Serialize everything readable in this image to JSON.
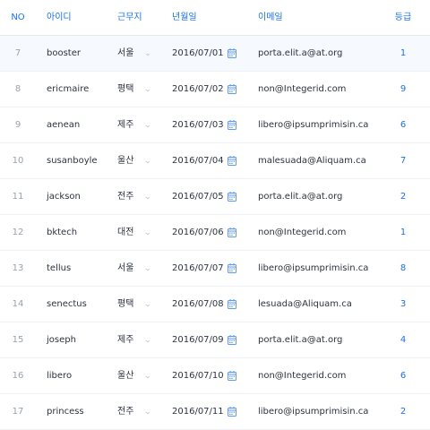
{
  "columns": {
    "no": "NO",
    "id": "아이디",
    "location": "근무지",
    "date": "년월일",
    "email": "이메일",
    "grade": "등급"
  },
  "icons": {
    "dropdown": "chevron-down-icon",
    "date": "calendar-icon"
  },
  "colors": {
    "accent": "#1a73e8",
    "selected_row": "#f6f9fd",
    "divider": "#eef1f5"
  },
  "rows": [
    {
      "no": "7",
      "id": "booster",
      "location": "서울",
      "date": "2016/07/01",
      "email": "porta.elit.a@at.org",
      "grade": "1"
    },
    {
      "no": "8",
      "id": "ericmaire",
      "location": "평택",
      "date": "2016/07/02",
      "email": "non@Integerid.com",
      "grade": "9"
    },
    {
      "no": "9",
      "id": "aenean",
      "location": "제주",
      "date": "2016/07/03",
      "email": "libero@ipsumprimisin.ca",
      "grade": "6"
    },
    {
      "no": "10",
      "id": "susanboyle",
      "location": "울산",
      "date": "2016/07/04",
      "email": "malesuada@Aliquam.ca",
      "grade": "7"
    },
    {
      "no": "11",
      "id": "jackson",
      "location": "전주",
      "date": "2016/07/05",
      "email": "porta.elit.a@at.org",
      "grade": "2"
    },
    {
      "no": "12",
      "id": "bktech",
      "location": "대전",
      "date": "2016/07/06",
      "email": "non@Integerid.com",
      "grade": "1"
    },
    {
      "no": "13",
      "id": "tellus",
      "location": "서울",
      "date": "2016/07/07",
      "email": "libero@ipsumprimisin.ca",
      "grade": "8"
    },
    {
      "no": "14",
      "id": "senectus",
      "location": "평택",
      "date": "2016/07/08",
      "email": "lesuada@Aliquam.ca",
      "grade": "3"
    },
    {
      "no": "15",
      "id": "joseph",
      "location": "제주",
      "date": "2016/07/09",
      "email": "porta.elit.a@at.org",
      "grade": "4"
    },
    {
      "no": "16",
      "id": "libero",
      "location": "울산",
      "date": "2016/07/10",
      "email": "non@Integerid.com",
      "grade": "6"
    },
    {
      "no": "17",
      "id": "princess",
      "location": "전주",
      "date": "2016/07/11",
      "email": "libero@ipsumprimisin.ca",
      "grade": "2"
    }
  ]
}
